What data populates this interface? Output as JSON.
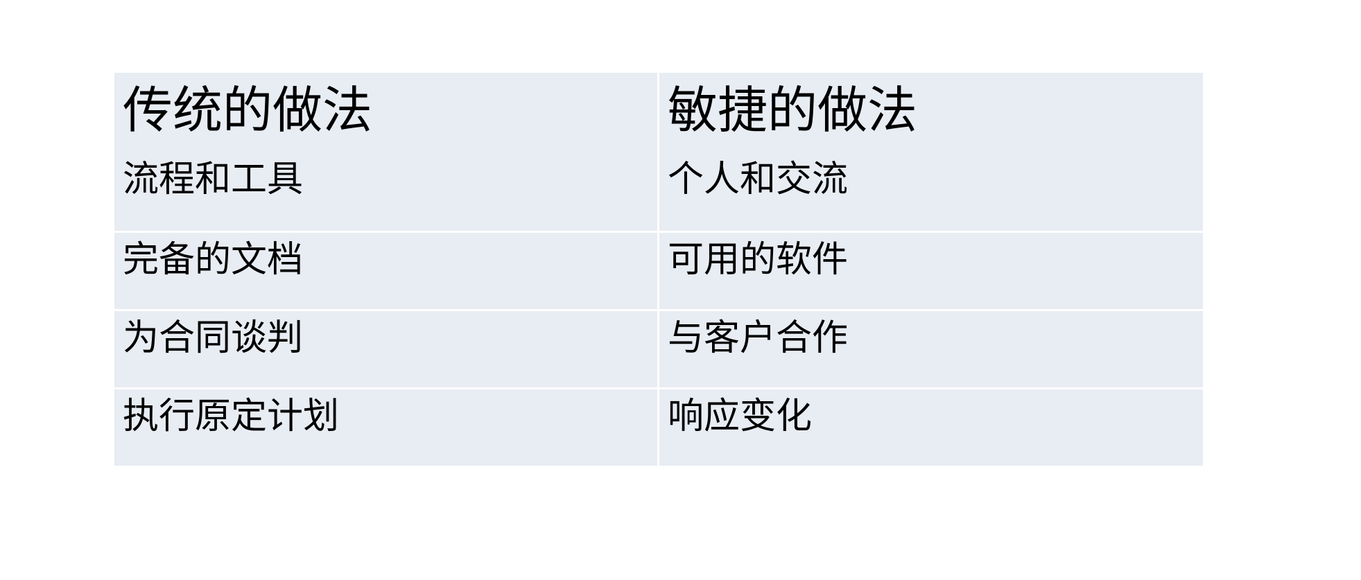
{
  "table": {
    "headers": [
      "传统的做法",
      "敏捷的做法"
    ],
    "rows": [
      [
        "流程和工具",
        "个人和交流"
      ],
      [
        "完备的文档",
        "可用的软件"
      ],
      [
        "为合同谈判",
        "与客户合作"
      ],
      [
        "执行原定计划",
        "响应变化"
      ]
    ]
  },
  "colors": {
    "cell_background": "#e8ecf3",
    "grid_line": "#ffffff",
    "text": "#000000",
    "page_background": "#ffffff"
  }
}
